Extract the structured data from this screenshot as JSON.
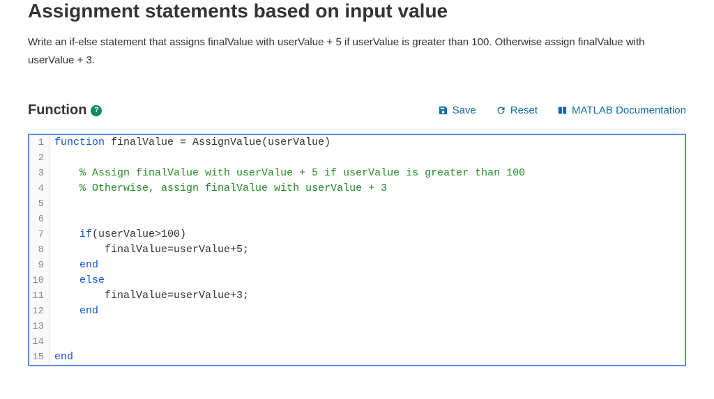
{
  "title": "Assignment statements based on input value",
  "instructions": "Write an if-else statement that assigns finalValue with userValue + 5 if userValue is greater than 100. Otherwise assign finalValue with userValue + 3.",
  "section_label": "Function",
  "help_badge": "?",
  "toolbar": {
    "save": "Save",
    "reset": "Reset",
    "docs": "MATLAB Documentation"
  },
  "code": {
    "lines": [
      {
        "n": "1",
        "html": "<span class='kw'>function</span> <span class='id'>finalValue = AssignValue(userValue)</span>"
      },
      {
        "n": "2",
        "html": ""
      },
      {
        "n": "3",
        "html": "    <span class='com'>% Assign finalValue with userValue + 5 if userValue is greater than 100</span>"
      },
      {
        "n": "4",
        "html": "    <span class='com'>% Otherwise, assign finalValue with userValue + 3</span>"
      },
      {
        "n": "5",
        "html": ""
      },
      {
        "n": "6",
        "html": ""
      },
      {
        "n": "7",
        "html": "    <span class='kw'>if</span><span class='id'>(userValue&gt;100)</span>"
      },
      {
        "n": "8",
        "html": "        <span class='id'>finalValue=userValue+5;</span>"
      },
      {
        "n": "9",
        "html": "    <span class='kw'>end</span>"
      },
      {
        "n": "10",
        "html": "    <span class='kw'>else</span>"
      },
      {
        "n": "11",
        "html": "        <span class='id'>finalValue=userValue+3;</span>"
      },
      {
        "n": "12",
        "html": "    <span class='kw'>end</span>"
      },
      {
        "n": "13",
        "html": ""
      },
      {
        "n": "14",
        "html": ""
      },
      {
        "n": "15",
        "html": "<span class='kw'>end</span>"
      }
    ]
  }
}
